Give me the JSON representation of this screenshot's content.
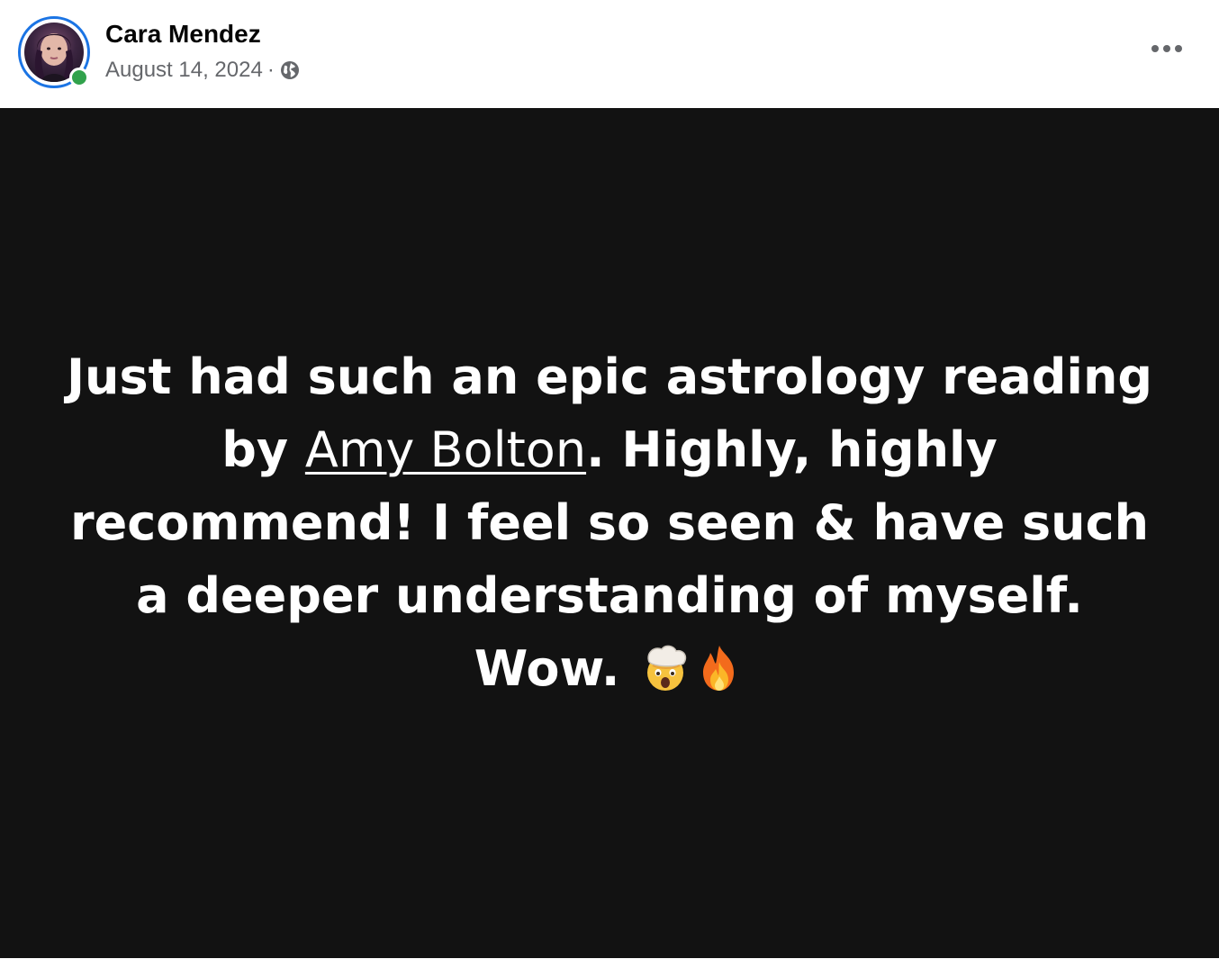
{
  "post": {
    "author_name": "Cara Mendez",
    "date": "August 14, 2024",
    "separator": "·",
    "audience_icon": "globe-icon",
    "more_icon": "more-options-icon",
    "background_color": "#121212",
    "text_color": "#ffffff",
    "text_before_mention": "Just had such an epic astrology reading by ",
    "mention": "Amy Bolton",
    "text_after_mention": ". Highly, highly recommend! I feel so seen & have such a deeper understanding of myself. Wow. ",
    "emojis": [
      "exploding-head-emoji",
      "fire-emoji"
    ]
  },
  "colors": {
    "ring": "#1b74e4",
    "presence": "#31a24c",
    "meta_text": "#65676b",
    "name_text": "#050505"
  }
}
